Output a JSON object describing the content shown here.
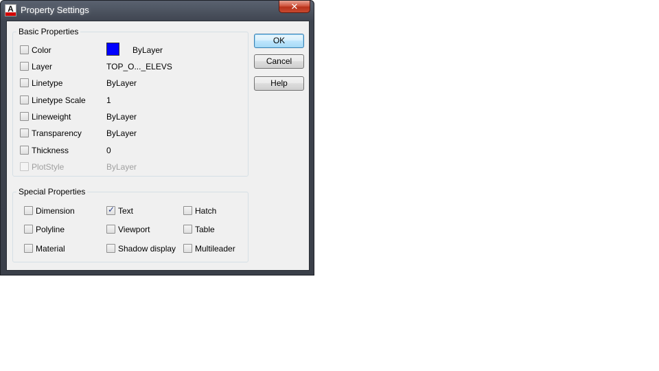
{
  "window": {
    "title": "Property Settings",
    "app_icon_letter": "A",
    "close_glyph": "✕"
  },
  "basic": {
    "legend": "Basic Properties",
    "rows": [
      {
        "label": "Color",
        "value": "ByLayer",
        "checked": false,
        "disabled": false,
        "swatch_color": "#0000ff"
      },
      {
        "label": "Layer",
        "value": "TOP_O..._ELEVS",
        "checked": false,
        "disabled": false
      },
      {
        "label": "Linetype",
        "value": "ByLayer",
        "checked": false,
        "disabled": false
      },
      {
        "label": "Linetype Scale",
        "value": "1",
        "checked": false,
        "disabled": false
      },
      {
        "label": "Lineweight",
        "value": "ByLayer",
        "checked": false,
        "disabled": false
      },
      {
        "label": "Transparency",
        "value": "ByLayer",
        "checked": false,
        "disabled": false
      },
      {
        "label": "Thickness",
        "value": "0",
        "checked": false,
        "disabled": false
      },
      {
        "label": "PlotStyle",
        "value": "ByLayer",
        "checked": false,
        "disabled": true
      }
    ]
  },
  "special": {
    "legend": "Special Properties",
    "items": [
      {
        "label": "Dimension",
        "checked": false
      },
      {
        "label": "Text",
        "checked": true
      },
      {
        "label": "Hatch",
        "checked": false
      },
      {
        "label": "Polyline",
        "checked": false
      },
      {
        "label": "Viewport",
        "checked": false
      },
      {
        "label": "Table",
        "checked": false
      },
      {
        "label": "Material",
        "checked": false
      },
      {
        "label": "Shadow display",
        "checked": false
      },
      {
        "label": "Multileader",
        "checked": false
      }
    ]
  },
  "buttons": {
    "ok": "OK",
    "cancel": "Cancel",
    "help": "Help"
  }
}
